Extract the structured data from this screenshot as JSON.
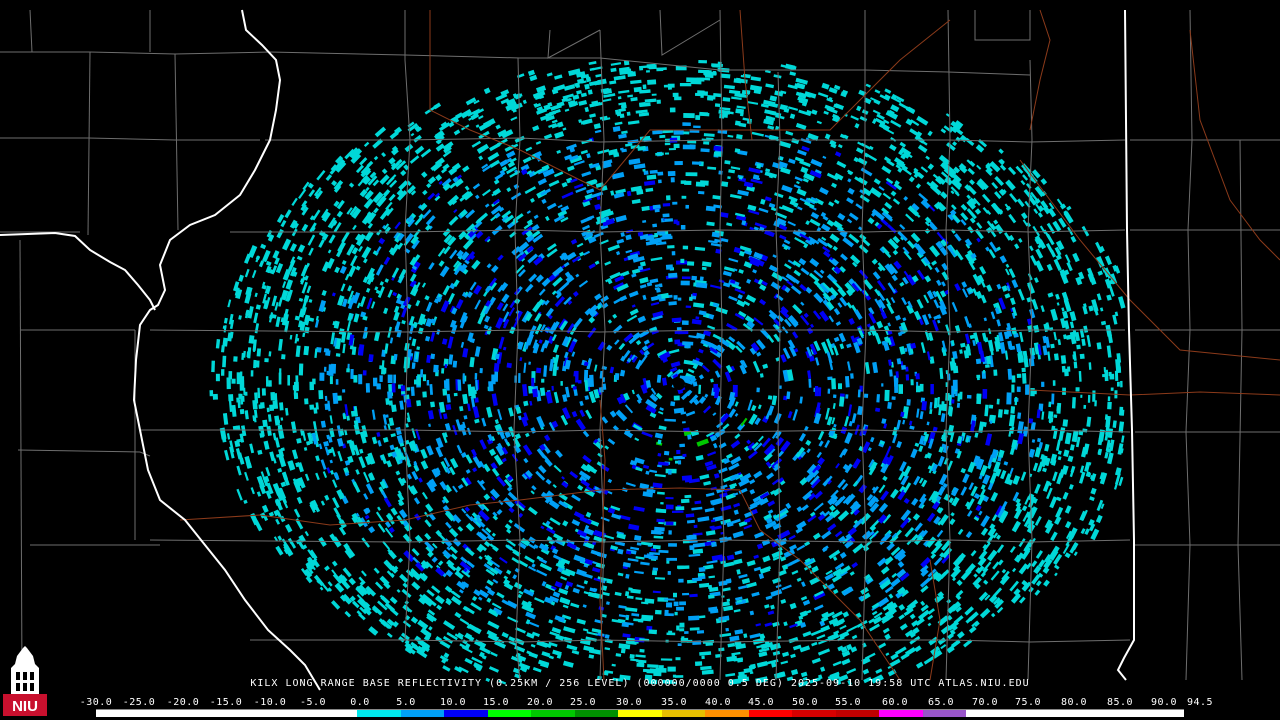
{
  "product": {
    "title": "KILX LONG RANGE BASE REFLECTIVITY (0.25KM / 256 LEVEL) (000000/0000 0.5 DEG) 2025-09-10 19:58 UTC  ATLAS.NIU.EDU",
    "station": "KILX",
    "elevation": "0.5 DEG",
    "timestamp": "2025-09-10 19:58 UTC"
  },
  "legend": {
    "ticks": [
      "-30.0",
      "-25.0",
      "-20.0",
      "-15.0",
      "-10.0",
      "-5.0",
      "0.0",
      "5.0",
      "10.0",
      "15.0",
      "20.0",
      "25.0",
      "30.0",
      "35.0",
      "40.0",
      "45.0",
      "50.0",
      "55.0",
      "60.0",
      "65.0",
      "70.0",
      "75.0",
      "80.0",
      "85.0",
      "90.0",
      "94.5"
    ],
    "colors": [
      "#ffffff",
      "#ffffff",
      "#ffffff",
      "#ffffff",
      "#ffffff",
      "#ffffff",
      "#00e8ec",
      "#00a0f6",
      "#0000f6",
      "#00ff00",
      "#00c800",
      "#009000",
      "#ffff00",
      "#e7c000",
      "#ff9000",
      "#ff0000",
      "#d60000",
      "#c00000",
      "#ff00ff",
      "#9955c9",
      "#ffffff",
      "#ffffff",
      "#ffffff",
      "#ffffff",
      "#ffffff"
    ]
  },
  "logo": {
    "text": "NIU",
    "colors": {
      "background": "#c8102e",
      "text": "#ffffff"
    }
  },
  "map": {
    "colors": {
      "background": "#000000",
      "county_lines": "#6e6e6e",
      "state_lines": "#ffffff",
      "highways": "#8b3a1a",
      "echo_light": "#00d8d8",
      "echo_mid": "#00a0f6",
      "echo_strong": "#0000f6",
      "echo_green": "#00c800"
    }
  }
}
